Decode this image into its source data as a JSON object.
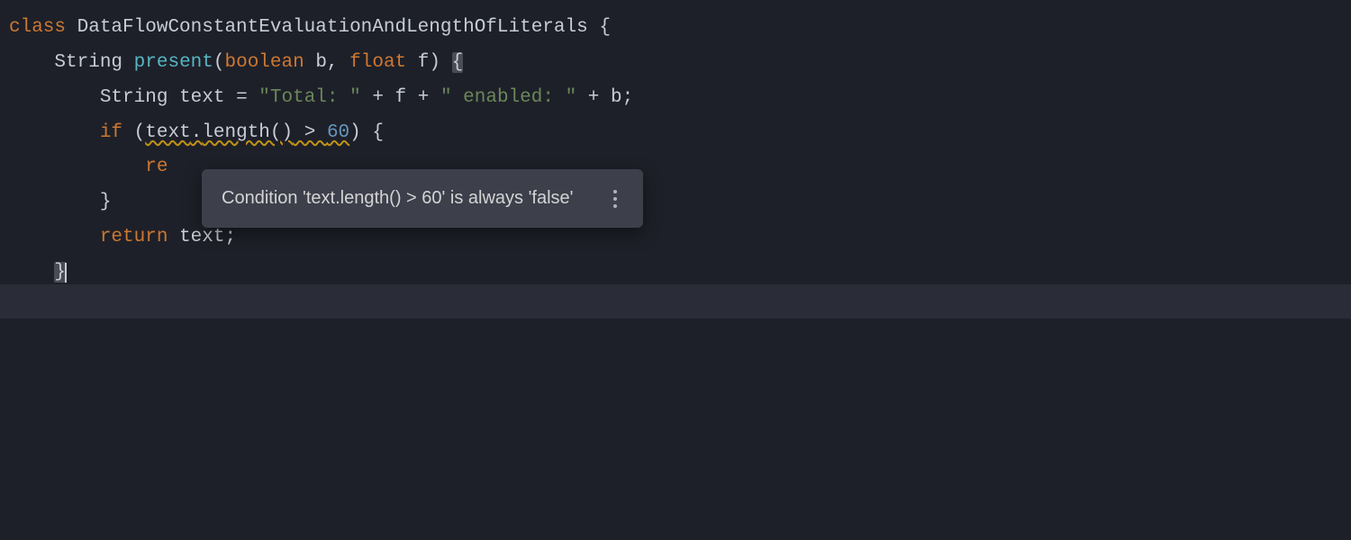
{
  "code": {
    "kw_class": "class",
    "class_name": "DataFlowConstantEvaluationAndLengthOfLiterals",
    "ret_type": "String",
    "method_name": "present",
    "param_bool_kw": "boolean",
    "param_bool_name": "b",
    "param_float_kw": "float",
    "param_float_name": "f",
    "decl_type": "String",
    "decl_name": "text",
    "eq": " = ",
    "str1": "\"Total: \"",
    "plus1": " + ",
    "var_f": "f",
    "plus2": " + ",
    "str2": "\" enabled: \"",
    "plus3": " + ",
    "var_b": "b",
    "semi": ";",
    "kw_if": "if",
    "cond_var": "text",
    "cond_dot": ".",
    "cond_call": "length()",
    "cond_op": " > ",
    "cond_num": "60",
    "partial_return": "re",
    "kw_return": "return",
    "ret_var": "text"
  },
  "tooltip": {
    "message": "Condition 'text.length() > 60' is always 'false'"
  }
}
